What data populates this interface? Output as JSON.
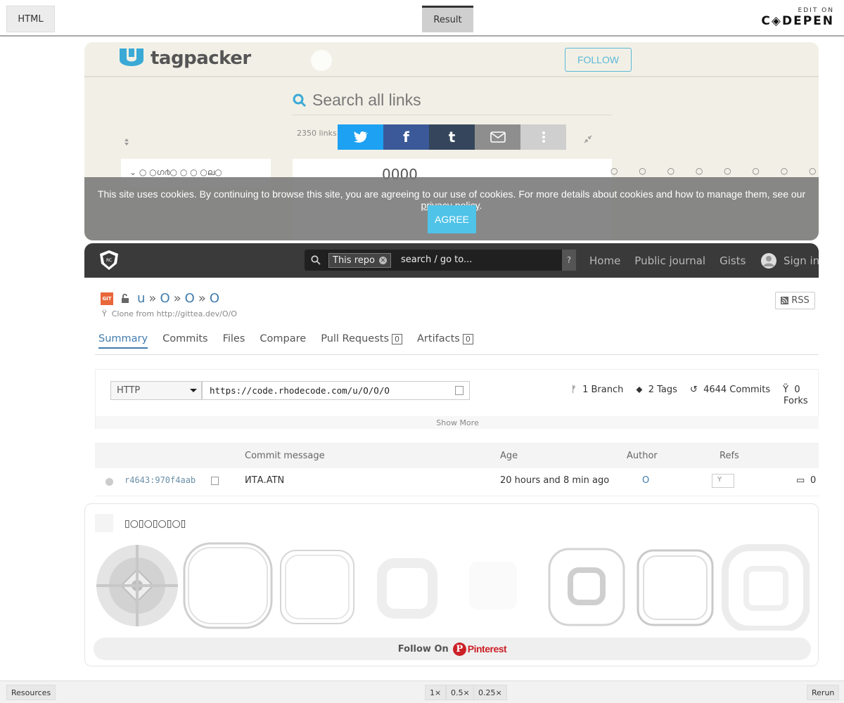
{
  "codepen": {
    "tab_html": "HTML",
    "tab_result": "Result",
    "edit_on": "EDIT ON",
    "logo": "C◈DEPEN",
    "resources": "Resources",
    "zoom_1": "1×",
    "zoom_05": "0.5×",
    "zoom_025": "0.25×",
    "rerun": "Rerun"
  },
  "tagpacker": {
    "brand": "tagpacker",
    "follow": "FOLLOW",
    "search_placeholder": "Search all links",
    "link_count": "2350 links",
    "main_card_text": "0000",
    "left_card_text": "⌄   ○   ○ഗ൪○   ○   ○   ○ല○",
    "dots": "○ ○ ○ ○ ○ ○ ○ ○ ○ ○ ○ ○",
    "share": [
      "twitter",
      "facebook",
      "tumblr",
      "email",
      "more"
    ]
  },
  "cookie": {
    "text": "This site uses cookies. By continuing to browse this site, you are agreeing to our use of cookies. For more details about cookies and how to manage them, see our ",
    "link": "privacy policy",
    "end": ".",
    "agree": "AGREE"
  },
  "rhodecode": {
    "scope_chip": "This repo",
    "search_placeholder": "search / go to...",
    "help": "?",
    "nav": [
      "Home",
      "Public journal",
      "Gists"
    ],
    "sign_in": "Sign in",
    "repo_type": "GIT",
    "crumbs": [
      "u",
      "O",
      "O",
      "O"
    ],
    "clone_from": "Clone from http://gittea.dev/O/O",
    "rss": "RSS",
    "tabs": {
      "summary": "Summary",
      "commits": "Commits",
      "files": "Files",
      "compare": "Compare",
      "pull_requests": "Pull Requests",
      "pull_requests_count": "0",
      "artifacts": "Artifacts",
      "artifacts_count": "0"
    },
    "protocol": "HTTP",
    "clone_url": "https://code.rhodecode.com/u/O/O/O",
    "stats": {
      "branches": "1 Branch",
      "tags": "2 Tags",
      "commits": "4644 Commits",
      "forks_count": "0",
      "forks_label": "Forks"
    },
    "show_more": "Show More",
    "table_headers": [
      "Commit message",
      "Age",
      "Author",
      "Refs"
    ],
    "commit": {
      "hash": "r4643:970f4aab",
      "message": "ИТА.ATN",
      "age": "20 hours and 8 min ago",
      "author": "O",
      "ref": "Y",
      "comments": "0"
    }
  },
  "pinterest": {
    "board_title": "▯○▯○▯○▯○▯",
    "follow_on": "Follow On",
    "brand": "Pinterest"
  },
  "colors": {
    "twitter": "#1da1f2",
    "facebook": "#3b5998",
    "tumblr": "#35465c",
    "email": "#8e8e8e",
    "more": "#cfcfcf",
    "accent_blue": "#427cac",
    "cookie_button": "#4fc3e8",
    "pinterest_red": "#cb2027"
  }
}
